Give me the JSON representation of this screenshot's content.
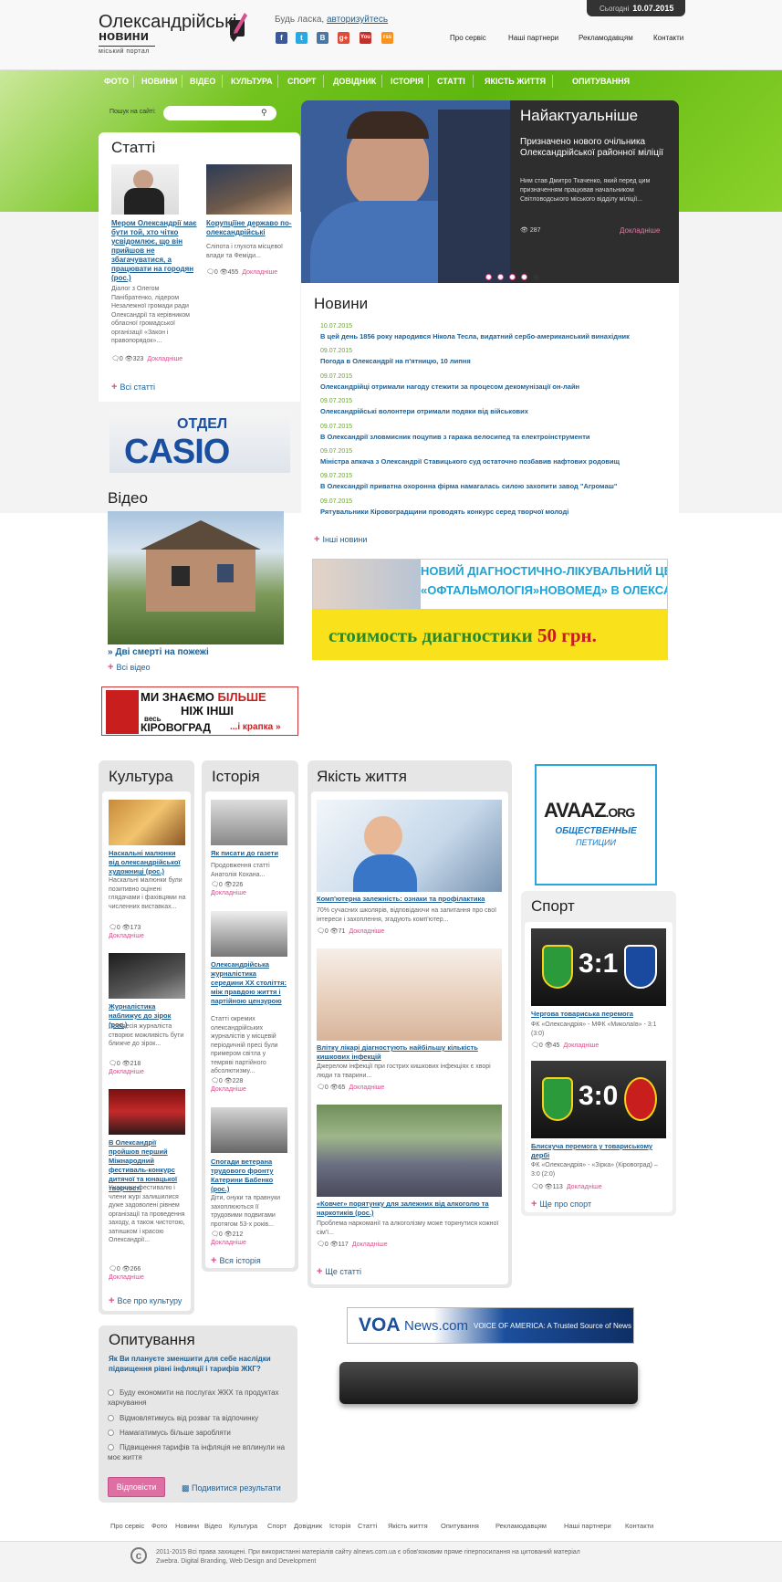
{
  "header": {
    "logo_line1": "Олександрійські",
    "logo_line2": "новини",
    "logo_tagline": "міський портал",
    "welcome_text": "Будь ласка,",
    "login_link": "авторизуйтесь",
    "date_label": "Сьогодні",
    "date_value": "10.07.2015",
    "links": [
      "Про сервіс",
      "Наші партнери",
      "Рекламодавцям",
      "Контакти"
    ],
    "social": [
      "f",
      "t",
      "B",
      "g+",
      "You",
      "rss"
    ]
  },
  "nav": [
    "ФОТО",
    "НОВИНИ",
    "ВІДЕО",
    "КУЛЬТУРА",
    "СПОРТ",
    "ДОВІДНИК",
    "ІСТОРІЯ",
    "СТАТТІ",
    "ЯКІСТЬ ЖИТТЯ",
    "ОПИТУВАННЯ"
  ],
  "search": {
    "label": "Пошук на сайті:"
  },
  "articles": {
    "title": "Статті",
    "items": [
      {
        "title": "Мером Олександрії має бути той, хто чітко усвідомлює, що він прийшов не збагачуватися, а працювати на городян (рос.)",
        "text": "Діалог з Олегом Панібратенко, лідером Незалежної громади ради Олександрії та керівником обласної громадської організації «Закон і правопорядок»...",
        "comments": "0",
        "views": "323"
      },
      {
        "title": "Корупціїне державо по-олександрійські",
        "text": "Сліпота і глухота місцевої влади та Феміди...",
        "comments": "0",
        "views": "455"
      }
    ],
    "more_label": "Докладніше",
    "all_label": "Всі статті"
  },
  "casio": {
    "top": "ОТДЕЛ",
    "brand": "CASIO"
  },
  "video": {
    "title": "Відео",
    "caption": "Дві смерті на пожежі",
    "all_label": "Всі відео"
  },
  "banner_left": {
    "line1": "МИ ЗНАЄМО",
    "line1b": "БІЛЬШЕ",
    "line2": "НІЖ ІНШІ",
    "line3": "весь",
    "line4": "КІРОВОГРАД",
    "line5": "...і крапка »"
  },
  "slider": {
    "title": "Найактуальніше",
    "headline": "Призначено нового очільника Олександрійської районної міліції",
    "text": "Ним став Дмитро Ткаченко, який перед цим призначенням працював начальником Світловодського міського відділу міліції...",
    "views": "287",
    "more_label": "Докладніше"
  },
  "news": {
    "title": "Новини",
    "items": [
      {
        "date": "10.07.2015",
        "title": "В цей день 1856 року народився Нікола Тесла, видатний сербо-американський винахідник"
      },
      {
        "date": "09.07.2015",
        "title": "Погода в Олександрії на п'ятницю, 10 липня"
      },
      {
        "date": "09.07.2015",
        "title": "Олександрійці отримали нагоду стежити за процесом декомунізації он-лайн"
      },
      {
        "date": "09.07.2015",
        "title": "Олександрійські волонтери отримали подяки від військових"
      },
      {
        "date": "09.07.2015",
        "title": "В Олександрії зловмисник поцупив з гаража велосипед та електроінструменти"
      },
      {
        "date": "09.07.2015",
        "title": "Міністра апкача з Олександрії Ставицького суд остаточно позбавив нафтових родовищ"
      },
      {
        "date": "09.07.2015",
        "title": "В Олександрії приватна охоронна фірма намагалась силою захопити завод \"Агромаш\""
      },
      {
        "date": "09.07.2015",
        "title": "Рятувальники Кіровоградщини проводять конкурс серед творчої молоді"
      }
    ],
    "other_label": "Інші новини"
  },
  "ad_center": {
    "line1": "НОВИЙ ДІАГНОСТИЧНО-ЛІКУВАЛЬНИЙ ЦЕНТР",
    "line2": "«ОФТАЛЬМОЛОГІЯ»НОВОМЕД» В ОЛЕКСАНДРІЇ",
    "line3": "стоимость диагностики",
    "price": "50 грн."
  },
  "culture": {
    "title": "Культура",
    "items": [
      {
        "title": "Наскальні малюнки від олександрійської художниці (рос.)",
        "text": "Наскальні малюнки були позитивно оцінені глядачами і фахівцями на численних виставках...",
        "comments": "0",
        "views": "173"
      },
      {
        "title": "Журналістика наближує до зірок (рос.)",
        "text": "Професія журналіста створює можливість бути ближче до зірок...",
        "comments": "0",
        "views": "218"
      },
      {
        "title": "В Олександрії пройшов перший Міжнародний фестиваль-конкурс дитячої та юнацької творчості",
        "text": "Учасники фестивалю і члени журі залишилися дуже задоволені рівнем організації та проведення заходу, а також чистотою, затишком і красою Олександрії...",
        "comments": "0",
        "views": "266"
      }
    ],
    "more_label": "Докладніше",
    "all_label": "Все про культуру"
  },
  "history": {
    "title": "Історія",
    "items": [
      {
        "title": "Як писати до газети",
        "text": "Продовження статті Анатолія Кохана...",
        "comments": "0",
        "views": "226"
      },
      {
        "title": "Олександрійська журналістика середини ХХ століття: між правдою життя і партійною цензурою",
        "text": "Статті окремих олександрійських журналістів у місцевій періодичній пресі були примером світла у темряві партійного абсолютизму...",
        "comments": "0",
        "views": "228"
      },
      {
        "title": "Спогади ветерана трудового фронту Катерини Бабенко (рос.)",
        "text": "Діти, онуки та правнуки захоплюються її трудовими подвигами протягом 53-х років...",
        "comments": "0",
        "views": "212"
      }
    ],
    "more_label": "Докладніше",
    "all_label": "Вся історія"
  },
  "quality": {
    "title": "Якість життя",
    "items": [
      {
        "title": "Комп'ютерна залежність: ознаки та профілактика",
        "text": "70% сучасних школярів, відповідаючи на запитання про свої інтереси і захоплення, згадують комп'ютер...",
        "comments": "0",
        "views": "71"
      },
      {
        "title": "Влітку лікарі діагностують найбільшу кількість кишкових інфекцій",
        "text": "Джерелом інфекції при гострих кишкових інфекціях є хворі люди та тварини...",
        "comments": "0",
        "views": "65"
      },
      {
        "title": "«Ковчег» порятунку для залежних від алкоголю та наркотиків (рос.)",
        "text": "Проблема наркоманії та алкоголізму може торкнутися кожної сім'ї...",
        "comments": "0",
        "views": "117"
      }
    ],
    "more_label": "Докладніше",
    "all_label": "Ще статті"
  },
  "avaaz": {
    "brand": "AVAAZ",
    "domain": ".ORG",
    "line1": "ОБЩЕСТВЕННЫЕ",
    "line2": "ПЕТИЦИИ"
  },
  "sport": {
    "title": "Спорт",
    "items": [
      {
        "title": "Чергова товариська перемога",
        "text": "ФК «Олександрія» - МФК «Миколаїв» - 3:1 (3:0)",
        "score": "3:1",
        "comments": "0",
        "views": "45"
      },
      {
        "title": "Блискуча перемога у товариському дербі",
        "text": "ФК «Олександрія» - «Зірка» (Кіровоград) – 3:0 (2:0)",
        "score": "3:0",
        "comments": "0",
        "views": "113"
      }
    ],
    "more_label": "Докладніше",
    "all_label": "Ще про спорт"
  },
  "voa": {
    "logo": "VOA",
    "news": "News.com",
    "tagline": "VOICE OF AMERICA: A Trusted Source of News"
  },
  "poll": {
    "title": "Опитування",
    "question": "Як Ви плануєте зменшити для себе наслідки підвищення рівні інфляції і тарифів ЖКГ?",
    "options": [
      "Буду економити на послугах ЖКХ та продуктах харчування",
      "Відмовлятимусь від розваг та відпочинку",
      "Намагатимусь більше заробляти",
      "Підвищення тарифів та інфляція не вплинули на моє життя"
    ],
    "vote_label": "Відповісти",
    "results_label": "Подивитися результати"
  },
  "footer": {
    "links": [
      "Про сервіс",
      "Фото",
      "Новини",
      "Відео",
      "Культура",
      "Спорт",
      "Довідник",
      "Історія",
      "Статті",
      "Якість життя",
      "Опитування",
      "Рекламодавцям",
      "Наші партнери",
      "Контакти"
    ],
    "copyright": "2011-2015 Всі права захищені. При використанні матеріалів сайту alnews.com.ua є обов'язковим пряме гіперпосилання на цитований матеріал",
    "credits": "Zwebra. Digital Branding, Web Design and Development"
  },
  "colors": {
    "accent_green": "#6cbf1a",
    "link_blue": "#1d5f93",
    "pink": "#d94f8d"
  }
}
